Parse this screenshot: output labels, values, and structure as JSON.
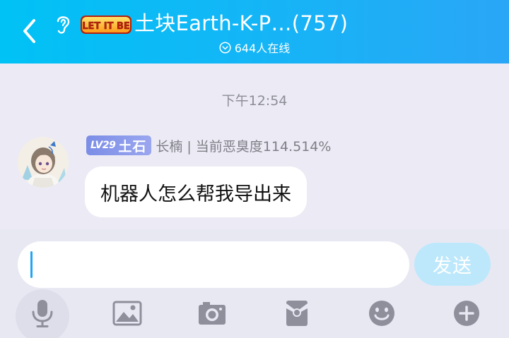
{
  "header": {
    "back_icon": "chevron-left-icon",
    "ear_icon": "ear-icon",
    "group_badge_text": "LET IT BE",
    "title": "土块Earth-K-P…(757)",
    "online_count": "644人在线",
    "background_color": "#14b6f6"
  },
  "chat": {
    "timestamp": "下午12:54",
    "messages": [
      {
        "level": "LV29",
        "title_badge": "土石",
        "sender": "长楠 | 当前恶臭度114.514%",
        "text": "机器人怎么帮我导出来"
      }
    ]
  },
  "input": {
    "value": "",
    "send_label": "发送",
    "accent_color": "#1fa5f3"
  },
  "toolbar": {
    "icons": [
      "microphone-icon",
      "image-icon",
      "camera-icon",
      "red-packet-icon",
      "emoji-icon",
      "plus-icon"
    ]
  }
}
